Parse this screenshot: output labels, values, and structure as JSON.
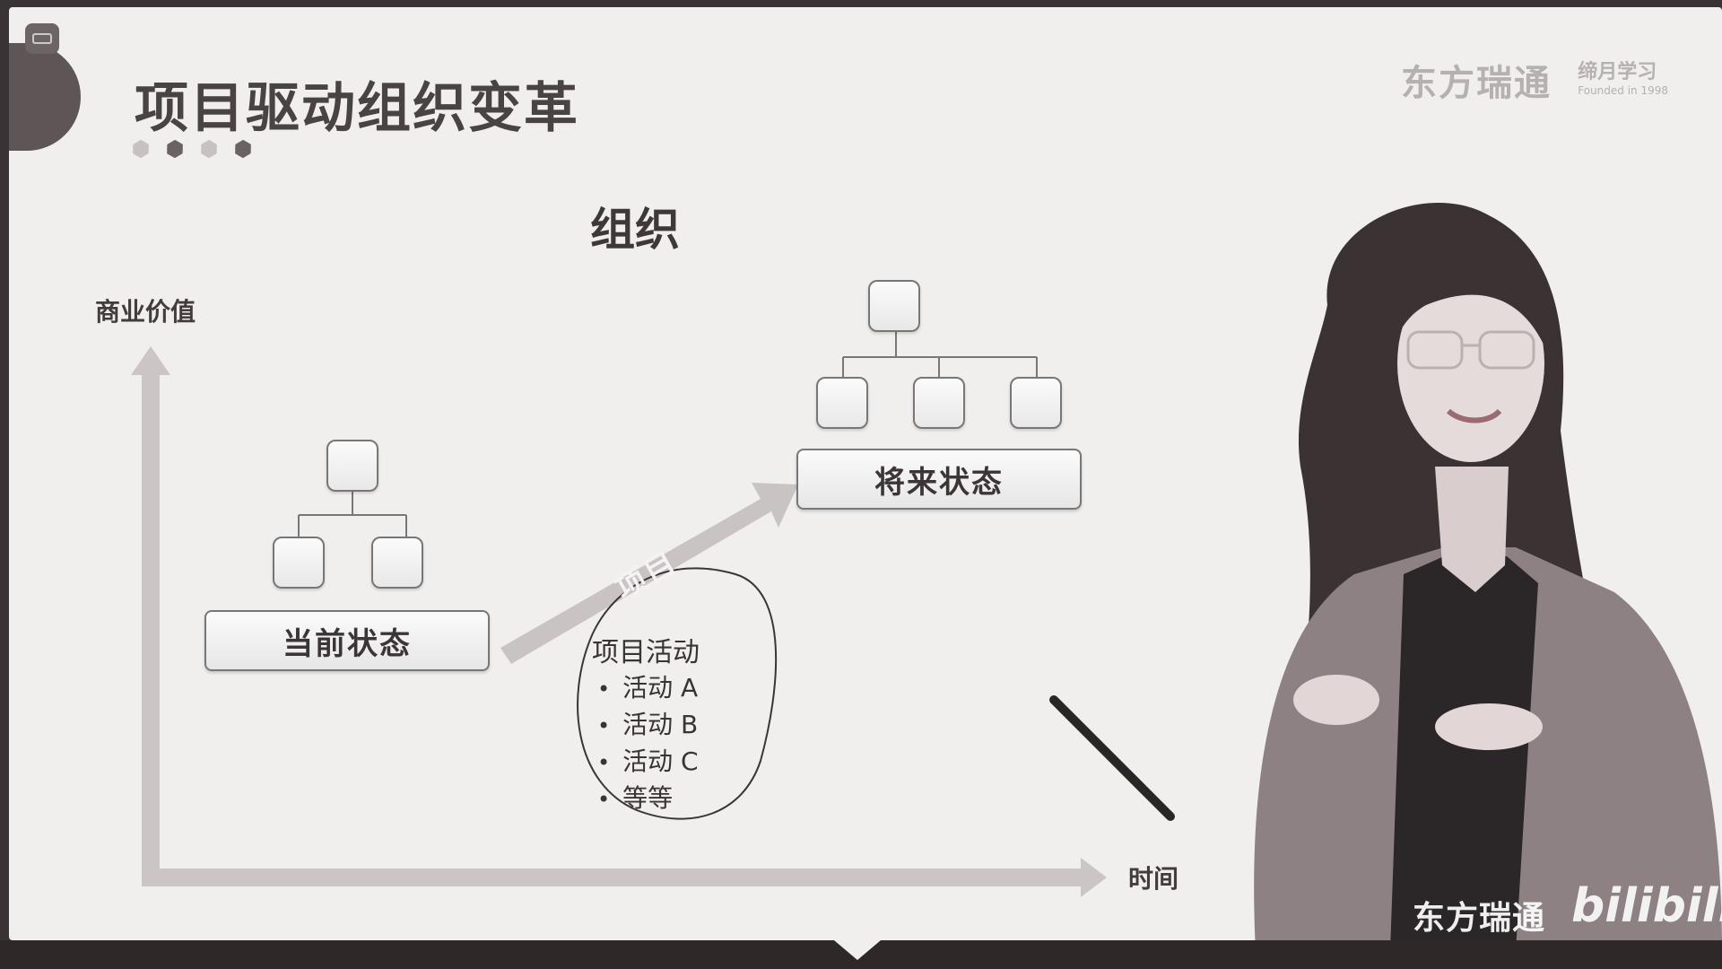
{
  "slide": {
    "title": "项目驱动组织变革",
    "brand": "东方瑞通",
    "brand_tag": "缔月学习",
    "brand_since": "Founded in 1998",
    "heading": "组织",
    "y_axis_label": "商业价值",
    "x_axis_label": "时间",
    "current_state": "当前状态",
    "future_state": "将来状态",
    "arrow_label": "项目",
    "activities": {
      "heading": "项目活动",
      "items": [
        "活动 A",
        "活动 B",
        "活动 C",
        "等等"
      ]
    }
  },
  "overlay": {
    "watermark": "东方瑞通",
    "platform": "bilibili"
  },
  "colors": {
    "slide_bg": "#f0efee",
    "accent_dark": "#5e5557",
    "text": "#3f3839",
    "arrow": "#c9c3c4"
  },
  "icons": [
    "hexagon-icon",
    "presenter-figure",
    "pen-icon"
  ]
}
